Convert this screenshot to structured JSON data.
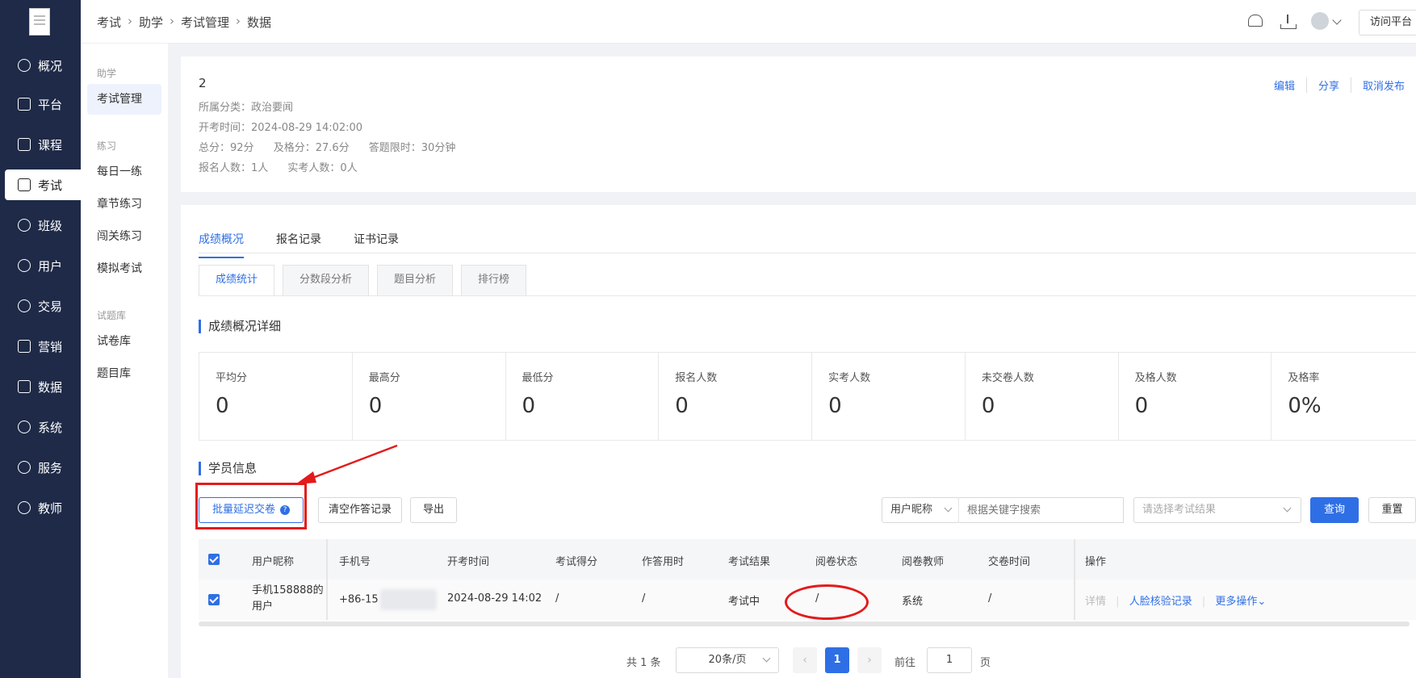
{
  "nav": {
    "items": [
      {
        "label": "概况",
        "icon": "clock-icon"
      },
      {
        "label": "平台",
        "icon": "store-icon"
      },
      {
        "label": "课程",
        "icon": "book-icon"
      },
      {
        "label": "考试",
        "icon": "exam-icon"
      },
      {
        "label": "班级",
        "icon": "group-icon"
      },
      {
        "label": "用户",
        "icon": "user-icon"
      },
      {
        "label": "交易",
        "icon": "yen-icon"
      },
      {
        "label": "营销",
        "icon": "megaphone-icon"
      },
      {
        "label": "数据",
        "icon": "bar-chart-icon"
      },
      {
        "label": "系统",
        "icon": "gear-icon"
      },
      {
        "label": "服务",
        "icon": "service-icon"
      },
      {
        "label": "教师",
        "icon": "teacher-icon"
      }
    ],
    "active": "考试"
  },
  "submenu": {
    "groups": [
      {
        "title": "助学",
        "items": [
          "考试管理"
        ]
      },
      {
        "title": "练习",
        "items": [
          "每日一练",
          "章节练习",
          "闯关练习",
          "模拟考试"
        ]
      },
      {
        "title": "试题库",
        "items": [
          "试卷库",
          "题目库"
        ]
      }
    ],
    "active": "考试管理"
  },
  "header": {
    "breadcrumb": [
      "考试",
      "助学",
      "考试管理",
      "数据"
    ],
    "visit_label": "访问平台"
  },
  "exam": {
    "name": "2",
    "category": "所属分类：政治要闻",
    "start_time": "开考时间：2024-08-29 14:02:00",
    "total_score": "总分：92分",
    "pass_score": "及格分：27.6分",
    "time_limit": "答题限时：30分钟",
    "registered": "报名人数：1人",
    "attended": "实考人数：0人",
    "actions": [
      "编辑",
      "分享",
      "取消发布"
    ]
  },
  "tabs": [
    "成绩概况",
    "报名记录",
    "证书记录"
  ],
  "subtabs": [
    "成绩统计",
    "分数段分析",
    "题目分析",
    "排行榜"
  ],
  "stats_title": "成绩概况详细",
  "stats": [
    {
      "label": "平均分",
      "value": "0"
    },
    {
      "label": "最高分",
      "value": "0"
    },
    {
      "label": "最低分",
      "value": "0"
    },
    {
      "label": "报名人数",
      "value": "0"
    },
    {
      "label": "实考人数",
      "value": "0"
    },
    {
      "label": "未交卷人数",
      "value": "0"
    },
    {
      "label": "及格人数",
      "value": "0"
    },
    {
      "label": "及格率",
      "value": "0%"
    }
  ],
  "students_title": "学员信息",
  "toolbar": {
    "batch_delay": "批量延迟交卷",
    "clear_records": "清空作答记录",
    "export": "导出",
    "filter_field": "用户昵称",
    "search_placeholder": "根据关键字搜索",
    "result_placeholder": "请选择考试结果",
    "query": "查询",
    "reset": "重置"
  },
  "table": {
    "columns": [
      "用户昵称",
      "手机号",
      "开考时间",
      "考试得分",
      "作答用时",
      "考试结果",
      "阅卷状态",
      "阅卷教师",
      "交卷时间",
      "操作"
    ],
    "rows": [
      {
        "nickname_line1": "手机158888的",
        "nickname_line2": "用户",
        "phone": "+86-15",
        "start_time": "2024-08-29 14:02",
        "score": "/",
        "duration": "/",
        "result": "考试中",
        "review_status": "/",
        "reviewer": "系统",
        "submit_time": "/",
        "actions": [
          "详情",
          "人脸核验记录",
          "更多操作"
        ]
      }
    ]
  },
  "pagination": {
    "total": "共 1 条",
    "page_size": "20条/页",
    "current": "1",
    "goto_label": "前往",
    "goto_value": "1",
    "page_unit": "页"
  },
  "colors": {
    "accent": "#2f6fe5",
    "sidebar": "#1e2a47",
    "annotation": "#e31b1b"
  }
}
